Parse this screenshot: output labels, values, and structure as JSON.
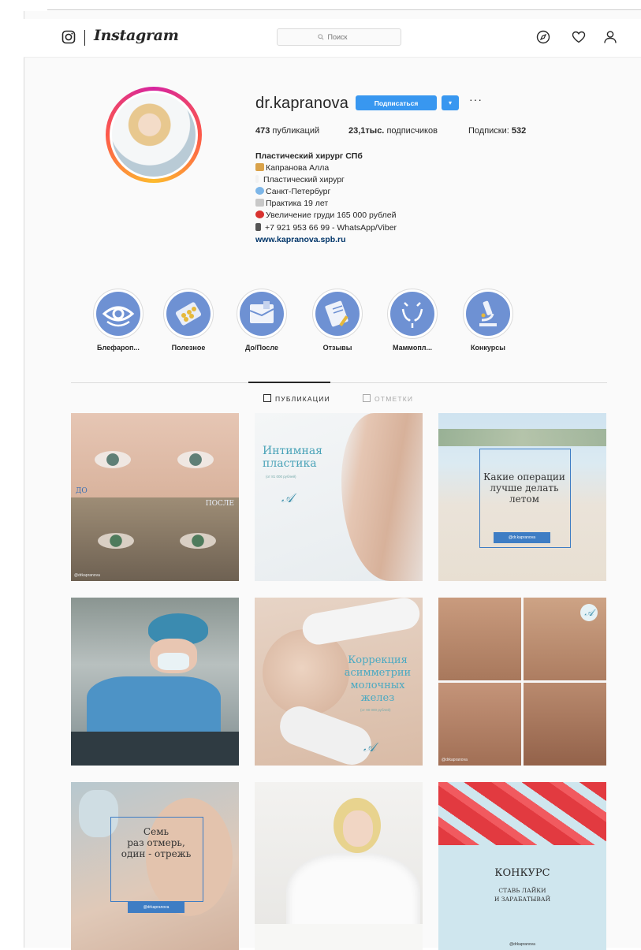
{
  "header": {
    "logo_text": "Instagram",
    "search_placeholder": "Поиск",
    "icons": [
      "camera-icon",
      "compass-icon",
      "heart-icon",
      "person-icon"
    ]
  },
  "profile": {
    "username": "dr.kapranova",
    "follow_label": "Подписаться",
    "dropdown_label": "▾",
    "more_label": "···",
    "stats": {
      "posts_value": "473",
      "posts_label": "публикаций",
      "followers_value": "23,1тыс.",
      "followers_label": "подписчиков",
      "following_label": "Подписки:",
      "following_value": "532"
    },
    "bio": {
      "title": "Пластический хирург СПб",
      "lines": [
        "Капранова Алла",
        "Пластический хирург",
        "Санкт-Петербург",
        "Практика 19 лет",
        "Увеличение груди 165 000 рублей",
        "+7 921 953 66 99 - WhatsApp/Viber"
      ],
      "link": "www.kapranova.spb.ru"
    }
  },
  "highlights": [
    {
      "label": "Блефароп...",
      "icon": "eye-icon"
    },
    {
      "label": "Полезное",
      "icon": "capsules-icon"
    },
    {
      "label": "До/После",
      "icon": "before-after-icon"
    },
    {
      "label": "Отзывы",
      "icon": "reviews-icon"
    },
    {
      "label": "Маммопл...",
      "icon": "mammoplasty-icon"
    },
    {
      "label": "Конкурсы",
      "icon": "microscope-icon"
    }
  ],
  "tabs": {
    "publications": "ПУБЛИКАЦИИ",
    "tagged": "ОТМЕТКИ"
  },
  "posts": {
    "p1": {
      "before": "ДО",
      "after": "ПОСЛЕ",
      "watermark": "@drkapranova"
    },
    "p2": {
      "title_line1": "Интимная",
      "title_line2": "пластика",
      "subtitle": "(от 81 000 рублей)"
    },
    "p3": {
      "line1": "Какие операции",
      "line2": "лучше делать",
      "line3": "летом",
      "badge": "@dr.kapranova"
    },
    "p5": {
      "line1": "Коррекция",
      "line2": "асимметрии",
      "line3": "молочных",
      "line4": "желез",
      "subtitle": "(от 90 000 рублей)"
    },
    "p6": {
      "watermark": "@drkapranova"
    },
    "p7": {
      "line1": "Семь",
      "line2": "раз отмерь,",
      "line3": "один - отрежь",
      "badge": "@drkapranova"
    },
    "p9": {
      "title": "КОНКУРС",
      "sub1": "СТАВЬ ЛАЙКИ",
      "sub2": "И ЗАРАБАТЫВАЙ",
      "watermark": "@drkapranova"
    }
  }
}
